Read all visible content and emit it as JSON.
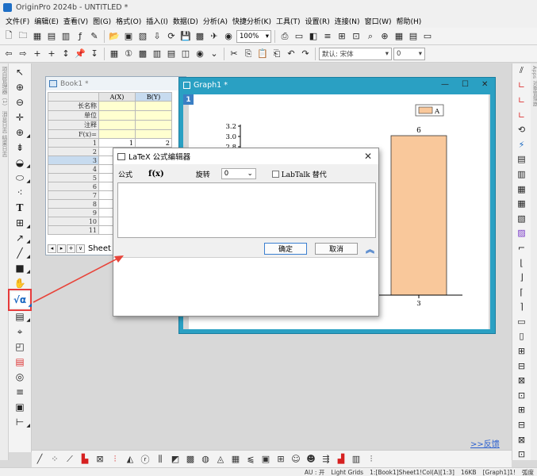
{
  "app": {
    "title": "OriginPro 2024b - UNTITLED *"
  },
  "menu": [
    "文件(F)",
    "编辑(E)",
    "查看(V)",
    "图(G)",
    "格式(O)",
    "插入(I)",
    "数据(D)",
    "分析(A)",
    "快捷分析(K)",
    "工具(T)",
    "设置(R)",
    "连接(N)",
    "窗口(W)",
    "帮助(H)"
  ],
  "toolbar": {
    "zoom": "100%",
    "font_name": "默认: 宋体",
    "font_size": "0"
  },
  "left_sidebar_text": "项目管理器（1）  消息日志  结果日志",
  "right_sidebar_text": "Apps  对象管理器",
  "book": {
    "title": "Book1 *",
    "columns": [
      "A(X)",
      "B(Y)"
    ],
    "meta_rows": [
      "长名称",
      "单位",
      "注释",
      "F(x)="
    ],
    "rows": [
      "1",
      "2",
      "3",
      "4",
      "5",
      "6",
      "7",
      "8",
      "9",
      "10",
      "11"
    ],
    "row1_values": [
      "1",
      "2"
    ],
    "sheet_name": "Sheet"
  },
  "graph": {
    "title": "Graph1 *",
    "layer": "1"
  },
  "chart_data": {
    "type": "bar",
    "categories": [
      "3"
    ],
    "series": [
      {
        "name": "A",
        "values": [
          6
        ],
        "color": "#f9c89b"
      }
    ],
    "data_labels": [
      "6"
    ],
    "ytick_labels": [
      "3.2",
      "3.0",
      "2.8"
    ],
    "legend": "top-right"
  },
  "dialog": {
    "title": "LaTeX 公式编辑器",
    "formula_label": "公式",
    "fx_label": "f(x)",
    "rotate_label": "旋转",
    "rotate_value": "0",
    "labtalk_label": "LabTalk 替代",
    "ok_label": "确定",
    "cancel_label": "取消"
  },
  "feedback": ">>反馈",
  "status": {
    "au": "AU : 开",
    "theme": "Light Grids",
    "path": "1:[Book1]Sheet1!Col(A)[1:3]",
    "size": "16KB",
    "graph": "[Graph1]1!",
    "unit": "弧度"
  },
  "colors": {
    "highlight": "#e63b3b",
    "graph_frame": "#2aa0c3",
    "bar_fill": "#f9c89b"
  }
}
